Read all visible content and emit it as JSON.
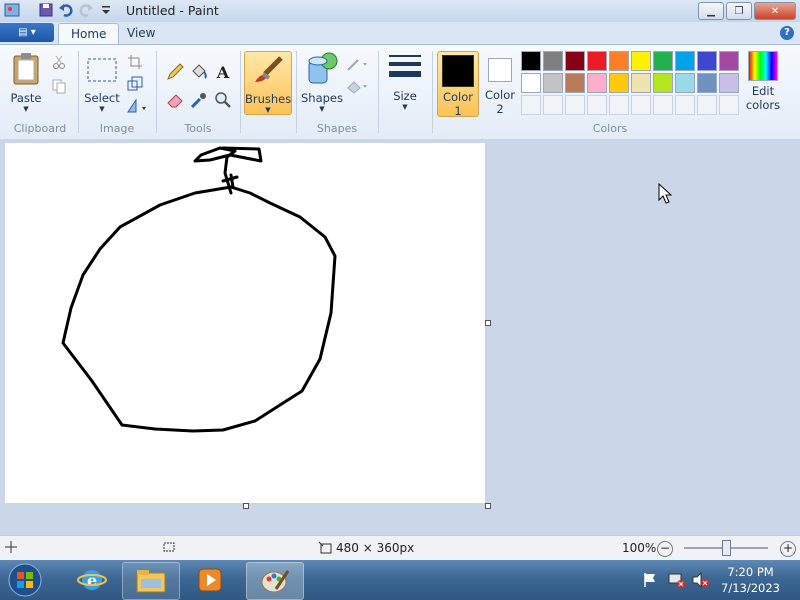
{
  "window": {
    "title": "Untitled - Paint"
  },
  "tabs": [
    {
      "label": "Home"
    },
    {
      "label": "View"
    }
  ],
  "ribbon": {
    "clipboard": {
      "paste": "Paste",
      "group": "Clipboard"
    },
    "image": {
      "select": "Select",
      "group": "Image"
    },
    "tools": {
      "group": "Tools"
    },
    "brushes": {
      "label": "Brushes"
    },
    "shapes": {
      "label": "Shapes",
      "group": "Shapes"
    },
    "size": {
      "label": "Size"
    },
    "color1": {
      "line1": "Color",
      "line2": "1",
      "color": "#000000"
    },
    "color2": {
      "line1": "Color",
      "line2": "2",
      "color": "#ffffff"
    },
    "edit_colors": {
      "line1": "Edit",
      "line2": "colors"
    },
    "colors_group": "Colors",
    "palette_row1": [
      "#000000",
      "#7f7f7f",
      "#880015",
      "#ed1c24",
      "#ff7f27",
      "#fff200",
      "#22b14c",
      "#00a2e8",
      "#3f48cc",
      "#a349a4"
    ],
    "palette_row2": [
      "#ffffff",
      "#c3c3c3",
      "#b97a57",
      "#ffaec9",
      "#ffc90e",
      "#efe4b0",
      "#b5e61d",
      "#99d9ea",
      "#7092be",
      "#c8bfe7"
    ]
  },
  "status": {
    "canvas_size": "480 × 360px",
    "zoom": "100%",
    "zoom_minus": "−",
    "zoom_plus": "+"
  },
  "taskbar": {
    "time": "7:20 PM",
    "date": "7/13/2023"
  }
}
